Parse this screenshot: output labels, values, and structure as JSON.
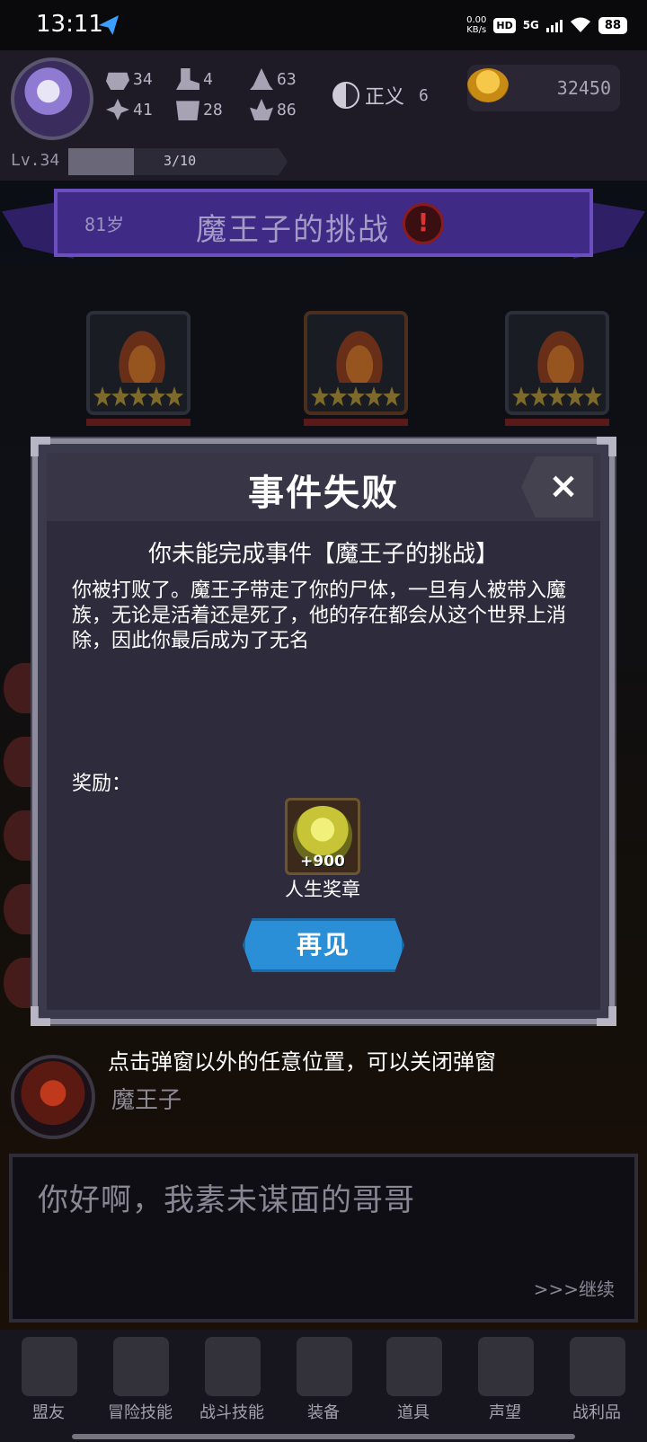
{
  "status_bar": {
    "time": "13:11",
    "net_speed_value": "0.00",
    "net_speed_unit": "KB/s",
    "hd_badge": "HD",
    "network": "5G",
    "battery": "88"
  },
  "player": {
    "stats": {
      "strength": "34",
      "agility": "4",
      "magic": "63",
      "luck": "41",
      "defense": "28",
      "spirit": "86"
    },
    "alignment_label": "正义",
    "alignment_value": "6",
    "coins": "32450",
    "level": "Lv.34",
    "xp_text": "3/10",
    "xp_fraction": 0.3
  },
  "event_banner": {
    "age": "81岁",
    "title": "魔王子的挑战",
    "alert": "!"
  },
  "dialog": {
    "title": "事件失败",
    "close": "×",
    "subtitle": "你未能完成事件【魔王子的挑战】",
    "body": "你被打败了。魔王子带走了你的尸体，一旦有人被带入魔族，无论是活着还是死了，他的存在都会从这个世界上消除，因此你最后成为了无名",
    "reward_label": "奖励：",
    "reward_amount": "+900",
    "reward_name": "人生奖章",
    "button_label": "再见"
  },
  "hint": "点击弹窗以外的任意位置，可以关闭弹窗",
  "speaker": {
    "name": "魔王子",
    "line": "你好啊，我素未谋面的哥哥",
    "continue": ">>>继续"
  },
  "nav": [
    {
      "label": "盟友",
      "icon": "handshake-icon"
    },
    {
      "label": "冒险技能",
      "icon": "book-icon"
    },
    {
      "label": "战斗技能",
      "icon": "backpack-icon"
    },
    {
      "label": "装备",
      "icon": "swords-icon"
    },
    {
      "label": "道具",
      "icon": "bag-icon"
    },
    {
      "label": "声望",
      "icon": "scroll-icon"
    },
    {
      "label": "战利品",
      "icon": "chest-icon"
    }
  ],
  "colors": {
    "banner": "#3f2a86",
    "dialog_bg": "#2e2c3c",
    "button_blue": "#2a8fd6",
    "alert_red": "#d33333"
  }
}
